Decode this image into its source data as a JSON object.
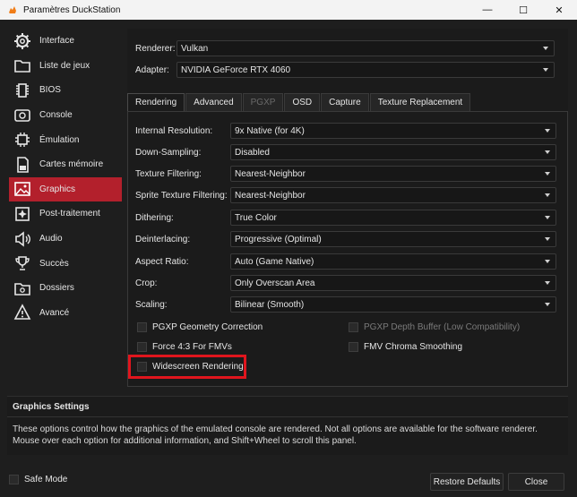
{
  "window": {
    "title": "Paramètres DuckStation"
  },
  "sidebar": {
    "items": [
      {
        "label": "Interface",
        "icon": "gear-icon"
      },
      {
        "label": "Liste de jeux",
        "icon": "folder-icon"
      },
      {
        "label": "BIOS",
        "icon": "chip-icon"
      },
      {
        "label": "Console",
        "icon": "console-icon"
      },
      {
        "label": "Émulation",
        "icon": "cpu-icon"
      },
      {
        "label": "Cartes mémoire",
        "icon": "memory-card-icon"
      },
      {
        "label": "Graphics",
        "icon": "image-icon"
      },
      {
        "label": "Post-traitement",
        "icon": "sparkle-icon"
      },
      {
        "label": "Audio",
        "icon": "speaker-icon"
      },
      {
        "label": "Succès",
        "icon": "trophy-icon"
      },
      {
        "label": "Dossiers",
        "icon": "folder-settings-icon"
      },
      {
        "label": "Avancé",
        "icon": "warning-icon"
      }
    ],
    "active_index": 6
  },
  "renderer": {
    "label": "Renderer:",
    "value": "Vulkan"
  },
  "adapter": {
    "label": "Adapter:",
    "value": "NVIDIA GeForce RTX 4060"
  },
  "tabs": [
    {
      "label": "Rendering",
      "state": "active"
    },
    {
      "label": "Advanced",
      "state": "normal"
    },
    {
      "label": "PGXP",
      "state": "disabled"
    },
    {
      "label": "OSD",
      "state": "normal"
    },
    {
      "label": "Capture",
      "state": "normal"
    },
    {
      "label": "Texture Replacement",
      "state": "normal"
    }
  ],
  "settings": [
    {
      "label": "Internal Resolution:",
      "value": "9x Native (for 4K)"
    },
    {
      "label": "Down-Sampling:",
      "value": "Disabled"
    },
    {
      "label": "Texture Filtering:",
      "value": "Nearest-Neighbor"
    },
    {
      "label": "Sprite Texture Filtering:",
      "value": "Nearest-Neighbor"
    },
    {
      "label": "Dithering:",
      "value": "True Color"
    },
    {
      "label": "Deinterlacing:",
      "value": "Progressive (Optimal)"
    },
    {
      "label": "Aspect Ratio:",
      "value": "Auto (Game Native)"
    },
    {
      "label": "Crop:",
      "value": "Only Overscan Area"
    },
    {
      "label": "Scaling:",
      "value": "Bilinear (Smooth)"
    }
  ],
  "checkboxes": {
    "pgxp_geometry": {
      "label": "PGXP Geometry Correction",
      "checked": false,
      "enabled": true
    },
    "pgxp_depth": {
      "label": "PGXP Depth Buffer (Low Compatibility)",
      "checked": false,
      "enabled": false
    },
    "force_43": {
      "label": "Force 4:3 For FMVs",
      "checked": false,
      "enabled": true
    },
    "fmv_chroma": {
      "label": "FMV Chroma Smoothing",
      "checked": false,
      "enabled": true
    },
    "widescreen": {
      "label": "Widescreen Rendering",
      "checked": false,
      "enabled": true
    }
  },
  "info": {
    "title": "Graphics Settings",
    "text": "These options control how the graphics of the emulated console are rendered. Not all options are available for the software renderer. Mouse over each option for additional information, and Shift+Wheel to scroll this panel."
  },
  "footer": {
    "safe_mode": "Safe Mode",
    "restore": "Restore Defaults",
    "close": "Close"
  },
  "colors": {
    "accent": "#b3202c",
    "highlight": "#e0151d"
  }
}
